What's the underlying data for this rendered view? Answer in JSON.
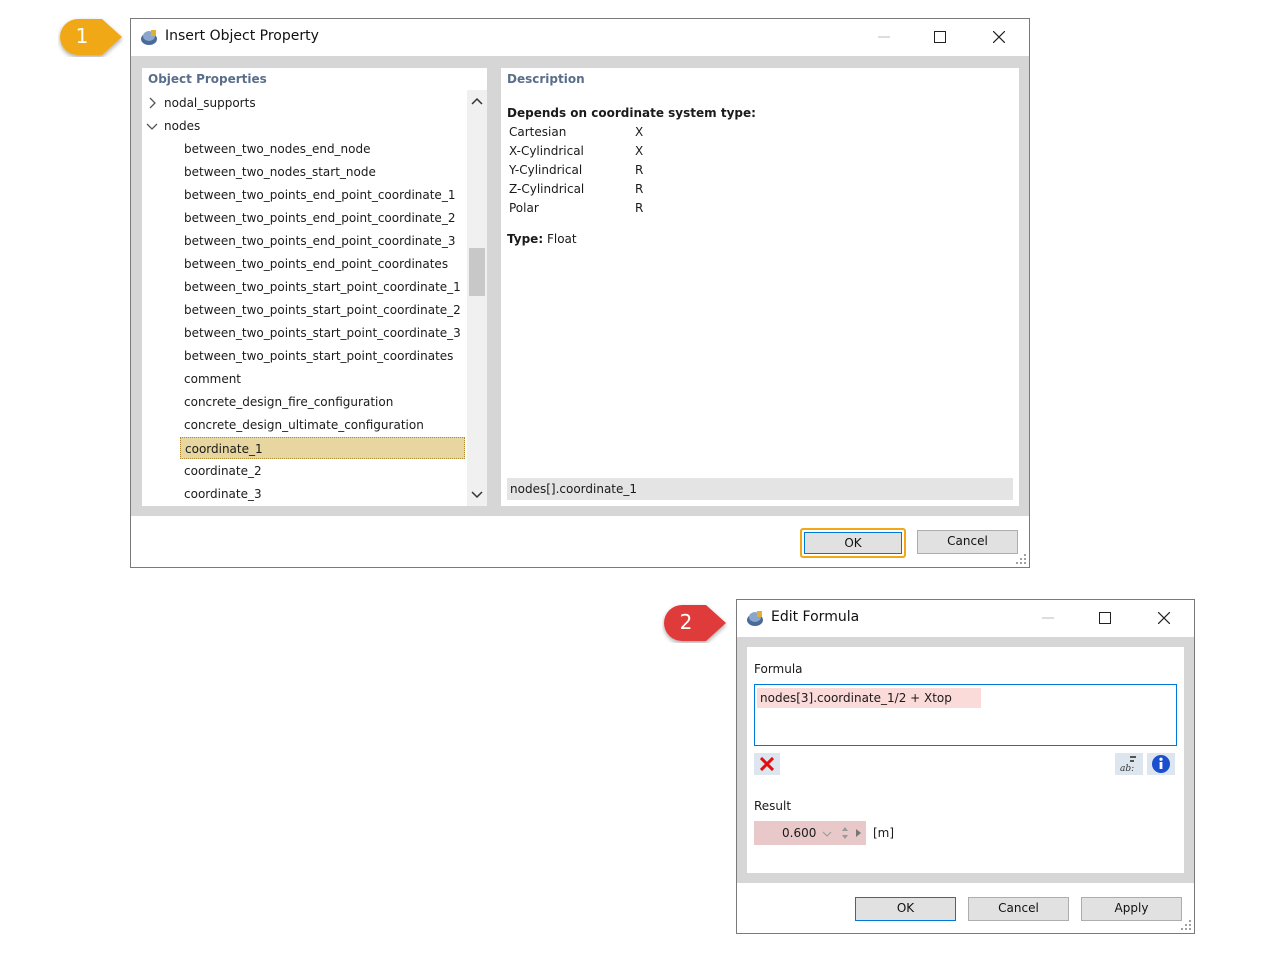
{
  "insert_dialog": {
    "callout": "1",
    "title": "Insert Object Property",
    "object_properties_header": "Object Properties",
    "tree": [
      {
        "label": "nodal_supports",
        "level": 0,
        "expand": "collapsed"
      },
      {
        "label": "nodes",
        "level": 0,
        "expand": "expanded"
      },
      {
        "label": "between_two_nodes_end_node",
        "level": 1
      },
      {
        "label": "between_two_nodes_start_node",
        "level": 1
      },
      {
        "label": "between_two_points_end_point_coordinate_1",
        "level": 1
      },
      {
        "label": "between_two_points_end_point_coordinate_2",
        "level": 1
      },
      {
        "label": "between_two_points_end_point_coordinate_3",
        "level": 1
      },
      {
        "label": "between_two_points_end_point_coordinates",
        "level": 1
      },
      {
        "label": "between_two_points_start_point_coordinate_1",
        "level": 1
      },
      {
        "label": "between_two_points_start_point_coordinate_2",
        "level": 1
      },
      {
        "label": "between_two_points_start_point_coordinate_3",
        "level": 1
      },
      {
        "label": "between_two_points_start_point_coordinates",
        "level": 1
      },
      {
        "label": "comment",
        "level": 1
      },
      {
        "label": "concrete_design_fire_configuration",
        "level": 1
      },
      {
        "label": "concrete_design_ultimate_configuration",
        "level": 1
      },
      {
        "label": "coordinate_1",
        "level": 1,
        "selected": true
      },
      {
        "label": "coordinate_2",
        "level": 1
      },
      {
        "label": "coordinate_3",
        "level": 1
      }
    ],
    "description_header": "Description",
    "depends_label": "Depends on coordinate system type:",
    "coord_systems": [
      {
        "name": "Cartesian",
        "value": "X"
      },
      {
        "name": "X-Cylindrical",
        "value": "X"
      },
      {
        "name": "Y-Cylindrical",
        "value": "R"
      },
      {
        "name": "Z-Cylindrical",
        "value": "R"
      },
      {
        "name": "Polar",
        "value": "R"
      }
    ],
    "type_label": "Type:",
    "type_value": "Float",
    "path_value": "nodes[].coordinate_1",
    "ok_label": "OK",
    "cancel_label": "Cancel"
  },
  "edit_dialog": {
    "callout": "2",
    "title": "Edit Formula",
    "formula_label": "Formula",
    "formula_value": "nodes[3].coordinate_1/2 + Xtop",
    "result_label": "Result",
    "result_value": "0.600",
    "result_unit": "[m]",
    "ok_label": "OK",
    "cancel_label": "Cancel",
    "apply_label": "Apply"
  },
  "colors": {
    "callout_1": "#f0a818",
    "callout_2": "#e03a3a",
    "highlight_orange": "#f0a818",
    "selection_bg": "#e8d6a0",
    "formula_bg": "#fbdada",
    "accent_blue": "#0078d7"
  }
}
